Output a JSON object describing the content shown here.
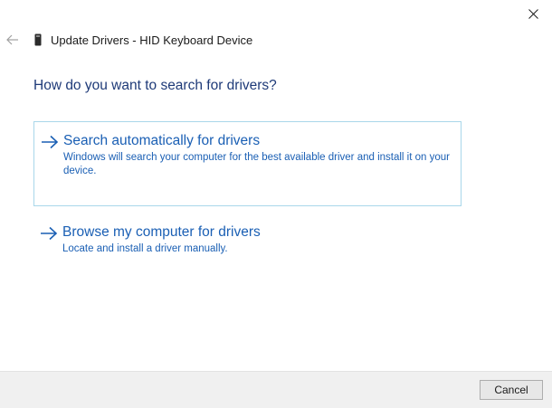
{
  "window": {
    "title": "Update Drivers - HID Keyboard Device",
    "close_icon": "close-icon",
    "back_icon": "back-arrow-icon",
    "device_icon": "keyboard-device-icon"
  },
  "main": {
    "question": "How do you want to search for drivers?",
    "options": [
      {
        "icon": "arrow-right-icon",
        "title": "Search automatically for drivers",
        "description": "Windows will search your computer for the best available driver and install it on your device."
      },
      {
        "icon": "arrow-right-icon",
        "title": "Browse my computer for drivers",
        "description": "Locate and install a driver manually."
      }
    ]
  },
  "footer": {
    "cancel_label": "Cancel"
  },
  "colors": {
    "link": "#1a5fb4",
    "heading": "#1e3a78",
    "selection_border": "#a9d7ea",
    "footer_bg": "#f0f0f0"
  }
}
